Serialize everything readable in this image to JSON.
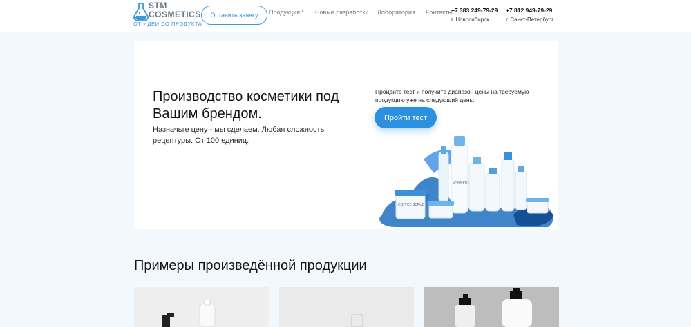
{
  "brand": {
    "line1": "STM",
    "line2": "COSMETICS",
    "tagline": "ОТ ИДЕИ ДО ПРОДУКТА",
    "accent": "#3d9ad8"
  },
  "header": {
    "cta_label": "Оставить заявку",
    "nav": {
      "products": "Продукция",
      "new": "Новые разработки",
      "lab": "Лоборатория",
      "contacts": "Контакты"
    },
    "contacts": [
      {
        "phone": "+7 383 249-79-29",
        "city": "г. Новосибирск"
      },
      {
        "phone": "+7 812 949-79-29",
        "city": "г. Санкт-Петербург"
      }
    ]
  },
  "hero": {
    "title": "Производство косметики под Вашим брендом.",
    "subtitle": "Назначьте цену - мы сделаем. Любая сложность рецептуры. От 100 единиц.",
    "test_text": "Пройдите тест и получите диапазон цены на требуемую продукцию уже на следующий день:",
    "test_button": "Пройти тест",
    "button_color": "#2c8fe0"
  },
  "examples": {
    "title": "Примеры произведённой продукции"
  },
  "products_labels": {
    "coffee_scrub": "COFFEE SCRUB",
    "shampoo": "SHAMPOO"
  }
}
